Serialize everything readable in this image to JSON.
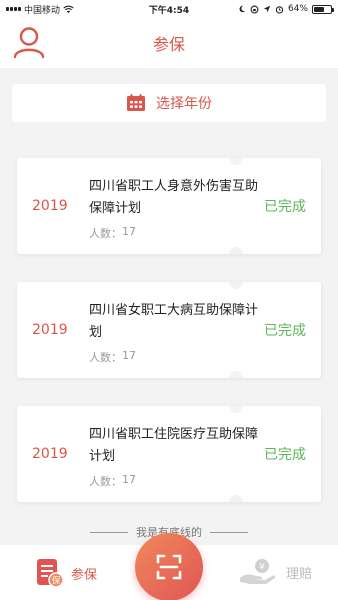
{
  "status_bar": {
    "carrier": "中国移动",
    "time": "下午4:54",
    "battery": "64%",
    "battery_level": 0.64
  },
  "header": {
    "title": "参保",
    "avatar_icon": "user-icon"
  },
  "year_picker": {
    "label": "选择年份",
    "icon": "calendar-icon"
  },
  "plans": [
    {
      "year": "2019",
      "name": "四川省职工人身意外伤害互助保障计划",
      "count_label": "人数：",
      "count": "17",
      "status": "已完成"
    },
    {
      "year": "2019",
      "name": "四川省女职工大病互助保障计划",
      "count_label": "人数：",
      "count": "17",
      "status": "已完成"
    },
    {
      "year": "2019",
      "name": "四川省职工住院医疗互助保障计划",
      "count_label": "人数：",
      "count": "17",
      "status": "已完成"
    }
  ],
  "footer_note": "我是有底线的",
  "tab_bar": {
    "left_label": "参保",
    "left_icon": "insurance-doc-icon",
    "center_icon": "scan-icon",
    "right_label": "理赔",
    "right_icon": "claim-hand-icon"
  },
  "colors": {
    "accent": "#d9574a",
    "success": "#5cb85c",
    "muted": "#999999"
  }
}
